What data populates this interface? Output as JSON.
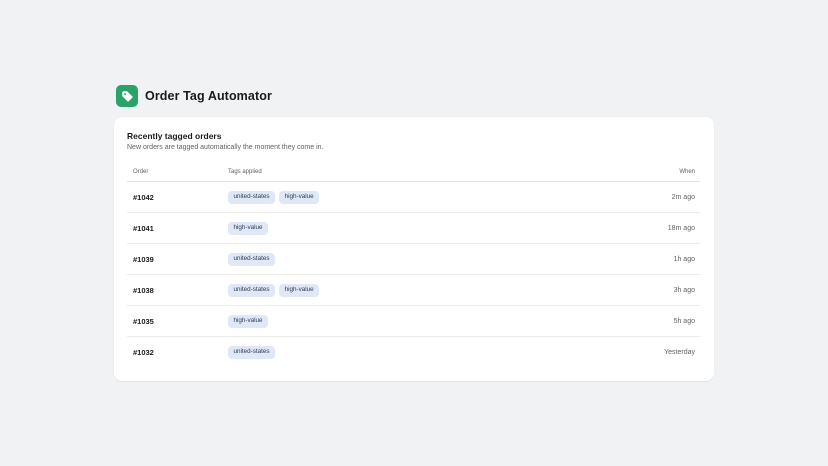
{
  "app": {
    "title": "Order Tag Automator",
    "logo_icon": "tag-icon",
    "accent_color": "#29a36a"
  },
  "card": {
    "title": "Recently tagged orders",
    "subtitle": "New orders are tagged automatically the moment they come in."
  },
  "table": {
    "headers": {
      "order": "Order",
      "tags": "Tags applied",
      "when": "When"
    },
    "rows": [
      {
        "order": "#1042",
        "tags": [
          "united-states",
          "high-value"
        ],
        "when": "2m ago"
      },
      {
        "order": "#1041",
        "tags": [
          "high-value"
        ],
        "when": "18m ago"
      },
      {
        "order": "#1039",
        "tags": [
          "united-states"
        ],
        "when": "1h ago"
      },
      {
        "order": "#1038",
        "tags": [
          "united-states",
          "high-value"
        ],
        "when": "3h ago"
      },
      {
        "order": "#1035",
        "tags": [
          "high-value"
        ],
        "when": "5h ago"
      },
      {
        "order": "#1032",
        "tags": [
          "united-states"
        ],
        "when": "Yesterday"
      }
    ]
  }
}
